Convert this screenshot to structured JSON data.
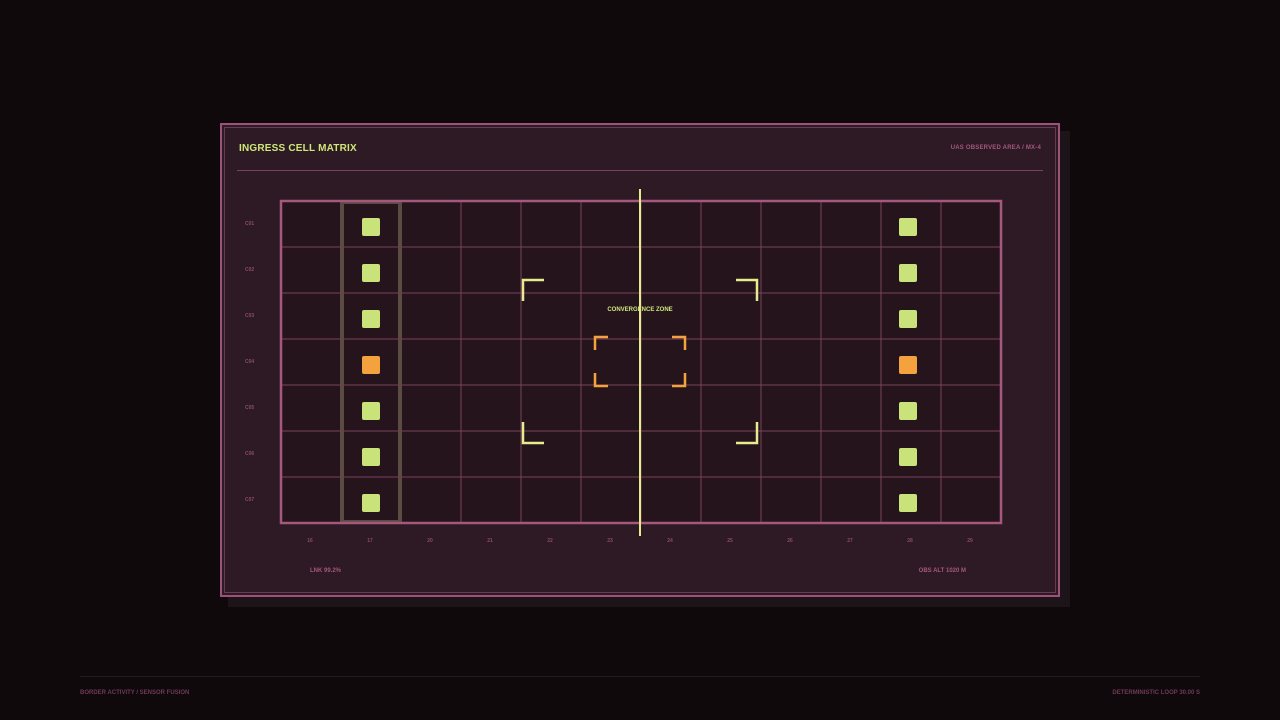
{
  "panel": {
    "title": "INGRESS CELL MATRIX",
    "subtitle": "UAS OBSERVED AREA / MX-4",
    "link_status": "LNK 99.2%",
    "obs_altitude": "OBS ALT 1020 M"
  },
  "matrix": {
    "rows": [
      "C01",
      "C02",
      "C03",
      "C04",
      "C05",
      "C06",
      "C07"
    ],
    "columns": [
      "16",
      "17",
      "20",
      "21",
      "22",
      "23",
      "24",
      "25",
      "26",
      "27",
      "28",
      "29"
    ],
    "highlighted_column": "17",
    "center_line_column_boundary": "23|24",
    "zone_label": "CONVERGENCE ZONE",
    "left_markers": [
      "ok",
      "ok",
      "ok",
      "alert",
      "ok",
      "ok",
      "ok"
    ],
    "right_markers": [
      "ok",
      "ok",
      "ok",
      "alert",
      "ok",
      "ok",
      "ok"
    ],
    "colors": {
      "ok": "#c9e27a",
      "alert": "#f3a23d",
      "grid": "#7a4260",
      "frame": "#a3587c",
      "accent": "#e4ec8c",
      "highlight": "#5c4a45"
    }
  },
  "footer": {
    "left": "BORDER ACTIVITY / SENSOR FUSION",
    "right": "DETERMINISTIC LOOP 30.00 S"
  }
}
